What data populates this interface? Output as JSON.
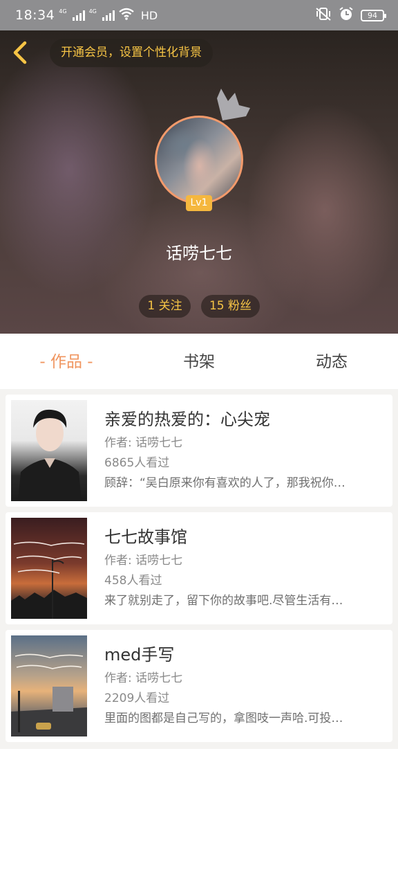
{
  "status_bar": {
    "time": "18:34",
    "network_1": "4G",
    "network_2": "4G",
    "hd_label": "HD",
    "battery": "94"
  },
  "header": {
    "vip_prompt": "开通会员，设置个性化背景",
    "level_badge": "Lv1",
    "nickname": "话唠七七",
    "following_label": "1 关注",
    "fans_label": "15 粉丝",
    "accent_color": "#f6c445"
  },
  "tabs": [
    {
      "label": "作品",
      "active": true
    },
    {
      "label": "书架",
      "active": false
    },
    {
      "label": "动态",
      "active": false
    }
  ],
  "works": [
    {
      "title": "亲爱的热爱的：心尖宠",
      "author": "作者: 话唠七七",
      "views": "6865人看过",
      "description": "顾辞：“吴白原来你有喜欢的人了，那我祝你…"
    },
    {
      "title": "七七故事馆",
      "author": "作者: 话唠七七",
      "views": "458人看过",
      "description": "来了就别走了，留下你的故事吧.尽管生活有…",
      "cover_text": "人的一生总会遇到惊艳时光的人，温柔了岁月"
    },
    {
      "title": "med手写",
      "author": "作者: 话唠七七",
      "views": "2209人看过",
      "description": "里面的图都是自己写的，拿图吱一声哈.可投…",
      "cover_text": "你路过的世界里，都有我想要的温柔"
    }
  ],
  "colors": {
    "tab_active": "#f0955f",
    "avatar_ring": "#f39a6b",
    "level_badge": "#f5b73e"
  }
}
